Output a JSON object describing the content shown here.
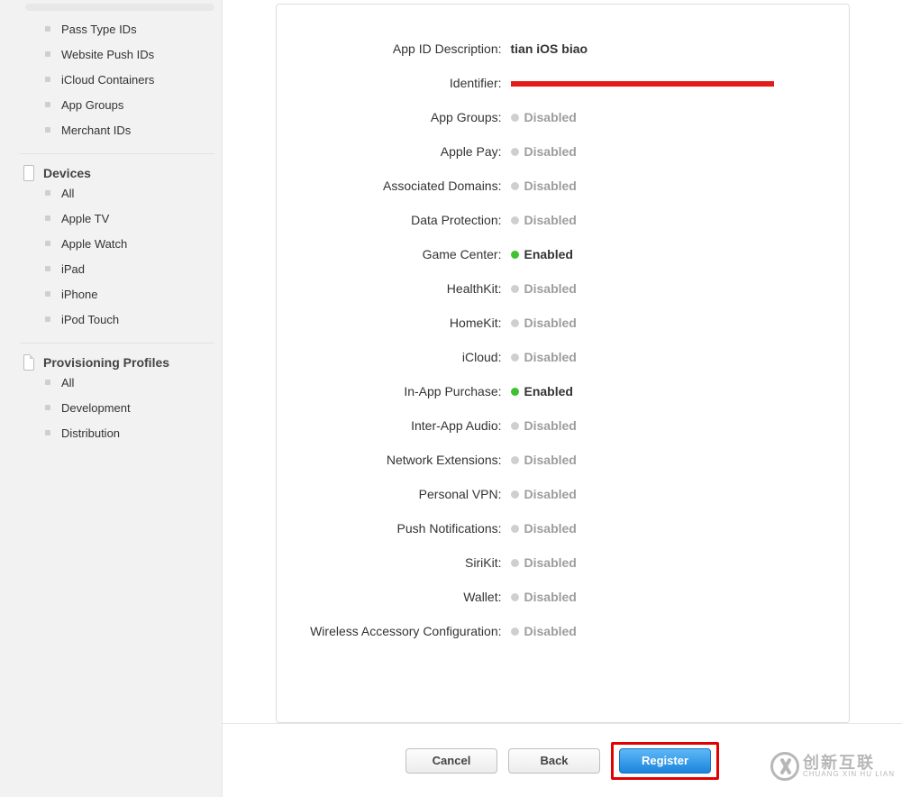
{
  "sidebar": {
    "group1": {
      "items": [
        {
          "label": "Pass Type IDs"
        },
        {
          "label": "Website Push IDs"
        },
        {
          "label": "iCloud Containers"
        },
        {
          "label": "App Groups"
        },
        {
          "label": "Merchant IDs"
        }
      ]
    },
    "group2": {
      "heading": "Devices",
      "items": [
        {
          "label": "All"
        },
        {
          "label": "Apple TV"
        },
        {
          "label": "Apple Watch"
        },
        {
          "label": "iPad"
        },
        {
          "label": "iPhone"
        },
        {
          "label": "iPod Touch"
        }
      ]
    },
    "group3": {
      "heading": "Provisioning Profiles",
      "items": [
        {
          "label": "All"
        },
        {
          "label": "Development"
        },
        {
          "label": "Distribution"
        }
      ]
    }
  },
  "detail": {
    "rows": [
      {
        "label": "App ID Description:",
        "type": "text",
        "value": "tian iOS biao"
      },
      {
        "label": "Identifier:",
        "type": "redacted"
      },
      {
        "label": "App Groups:",
        "type": "status",
        "status": "disabled",
        "value": "Disabled"
      },
      {
        "label": "Apple Pay:",
        "type": "status",
        "status": "disabled",
        "value": "Disabled"
      },
      {
        "label": "Associated Domains:",
        "type": "status",
        "status": "disabled",
        "value": "Disabled"
      },
      {
        "label": "Data Protection:",
        "type": "status",
        "status": "disabled",
        "value": "Disabled"
      },
      {
        "label": "Game Center:",
        "type": "status",
        "status": "enabled",
        "value": "Enabled"
      },
      {
        "label": "HealthKit:",
        "type": "status",
        "status": "disabled",
        "value": "Disabled"
      },
      {
        "label": "HomeKit:",
        "type": "status",
        "status": "disabled",
        "value": "Disabled"
      },
      {
        "label": "iCloud:",
        "type": "status",
        "status": "disabled",
        "value": "Disabled"
      },
      {
        "label": "In-App Purchase:",
        "type": "status",
        "status": "enabled",
        "value": "Enabled"
      },
      {
        "label": "Inter-App Audio:",
        "type": "status",
        "status": "disabled",
        "value": "Disabled"
      },
      {
        "label": "Network Extensions:",
        "type": "status",
        "status": "disabled",
        "value": "Disabled"
      },
      {
        "label": "Personal VPN:",
        "type": "status",
        "status": "disabled",
        "value": "Disabled"
      },
      {
        "label": "Push Notifications:",
        "type": "status",
        "status": "disabled",
        "value": "Disabled"
      },
      {
        "label": "SiriKit:",
        "type": "status",
        "status": "disabled",
        "value": "Disabled"
      },
      {
        "label": "Wallet:",
        "type": "status",
        "status": "disabled",
        "value": "Disabled"
      },
      {
        "label": "Wireless Accessory Configuration:",
        "type": "status",
        "status": "disabled",
        "value": "Disabled"
      }
    ]
  },
  "buttons": {
    "cancel": "Cancel",
    "back": "Back",
    "register": "Register"
  },
  "watermark": {
    "line1": "创新互联",
    "line2": "CHUANG XIN HU LIAN"
  }
}
